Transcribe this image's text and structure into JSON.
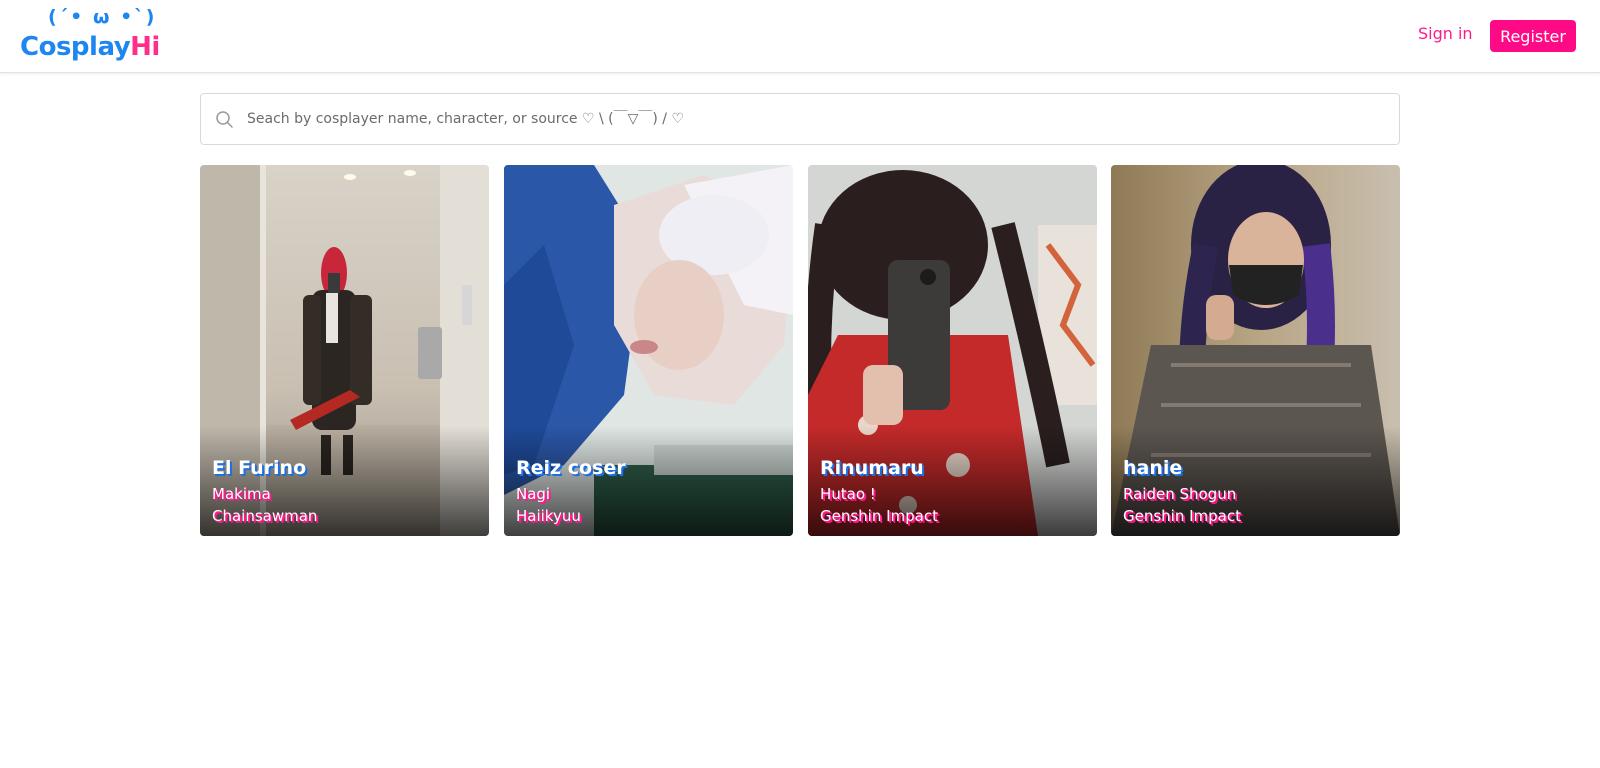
{
  "header": {
    "logo_face": "(´• ω •`)",
    "logo_part1": "Cosplay",
    "logo_part2": "Hi",
    "signin_label": "Sign in",
    "register_label": "Register"
  },
  "search": {
    "icon": "search-icon",
    "placeholder": "Seach by cosplayer name, character, or source ♡ \\ (￣▽￣) / ♡",
    "value": ""
  },
  "cards": [
    {
      "name": "El Furino",
      "character": "Makima",
      "source": "Chainsawman"
    },
    {
      "name": "Reiz coser",
      "character": "Nagi",
      "source": "Haiikyuu"
    },
    {
      "name": "Rinumaru",
      "character": "Hutao !",
      "source": "Genshin Impact"
    },
    {
      "name": "hanie",
      "character": "Raiden Shogun",
      "source": "Genshin Impact"
    }
  ],
  "colors": {
    "brand_blue": "#1e86f0",
    "brand_pink": "#ff0a86"
  }
}
